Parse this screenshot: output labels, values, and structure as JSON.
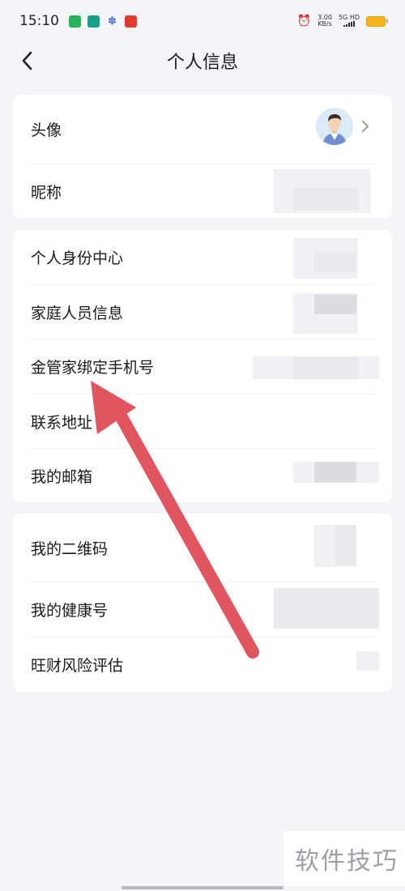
{
  "status_bar": {
    "time": "15:10",
    "net_speed_value": "3.00",
    "net_speed_unit": "KB/s",
    "signal_label": "5G HD"
  },
  "nav": {
    "title": "个人信息",
    "back_icon": "chevron-left-icon"
  },
  "section1": {
    "rows": [
      {
        "label": "头像"
      },
      {
        "label": "昵称"
      }
    ]
  },
  "section2": {
    "rows": [
      {
        "label": "个人身份中心"
      },
      {
        "label": "家庭人员信息"
      },
      {
        "label": "金管家绑定手机号"
      },
      {
        "label": "联系地址"
      },
      {
        "label": "我的邮箱"
      }
    ]
  },
  "section3": {
    "rows": [
      {
        "label": "我的二维码"
      },
      {
        "label": "我的健康号"
      },
      {
        "label": "旺财风险评估"
      }
    ]
  },
  "watermark": "软件技巧",
  "colors": {
    "background": "#f4f5f9",
    "card": "#ffffff",
    "annotation_arrow": "#e0555f",
    "battery": "#f5b21a"
  }
}
